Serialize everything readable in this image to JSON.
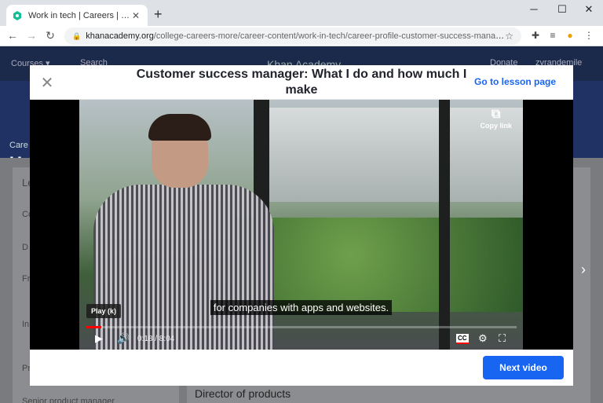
{
  "browser": {
    "tab_title": "Work in tech | Careers | College, c",
    "tab_close": "✕",
    "new_tab": "+",
    "url_host": "khanacademy.org",
    "url_path": "/college-careers-more/career-content/work-in-tech/career-profile-customer-success-manage...",
    "window_controls": [
      "─",
      "☐",
      "✕"
    ]
  },
  "background_page": {
    "nav_left": [
      "Courses ▾",
      "Search"
    ],
    "logo_text": "Khan Academy",
    "nav_right": [
      "Donate",
      "zyrandemile"
    ],
    "breadcrumb": "Care",
    "unit_title": "Un",
    "sidebar_rows": [
      "Le",
      "Co",
      "D",
      "Fr co",
      "In fo",
      "Pr",
      "Senior product manager"
    ],
    "director_heading": "Director of products"
  },
  "modal": {
    "close_icon": "✕",
    "title": "Customer success manager: What I do and how much I make",
    "lesson_link": "Go to lesson page",
    "next_video": "Next video"
  },
  "video": {
    "copy_link": "Copy link",
    "caption": "for companies with apps and websites.",
    "play_tooltip": "Play (k)",
    "time_current": "0:18",
    "time_total": "8:04",
    "time_display": "0:18 / 8:04",
    "cc_label": "CC",
    "progress_fraction": 0.037
  }
}
